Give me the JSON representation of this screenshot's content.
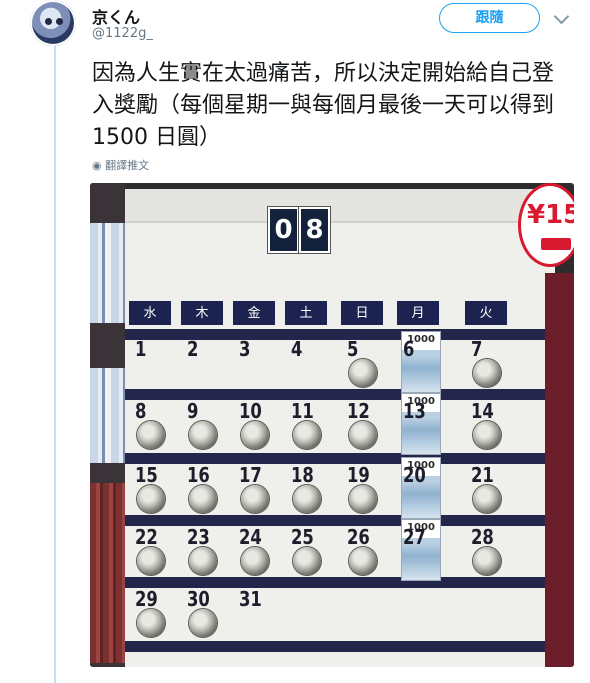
{
  "user": {
    "display_name": "京くん",
    "handle": "@1122g_"
  },
  "actions": {
    "follow_label": "跟隨"
  },
  "tweet": {
    "text": "因為人生實在太過痛苦，所以決定開始給自己登入獎勵（每個星期一與每個月最後一天可以得到 1500 日圓）",
    "translate_label": "翻譯推文"
  },
  "photo": {
    "price_badge": "¥15",
    "month_display": [
      "0",
      "8"
    ],
    "weekdays": [
      "水",
      "木",
      "金",
      "土",
      "日",
      "月",
      "火"
    ],
    "days": [
      "1",
      "2",
      "3",
      "4",
      "5",
      "6",
      "7",
      "8",
      "9",
      "10",
      "11",
      "12",
      "13",
      "14",
      "15",
      "16",
      "17",
      "18",
      "19",
      "20",
      "21",
      "22",
      "23",
      "24",
      "25",
      "26",
      "27",
      "28",
      "29",
      "30",
      "31"
    ],
    "bill_label": "1000"
  },
  "colors": {
    "accent": "#1da1f2",
    "chart_navy": "#23254a",
    "price_red": "#d8192f"
  }
}
